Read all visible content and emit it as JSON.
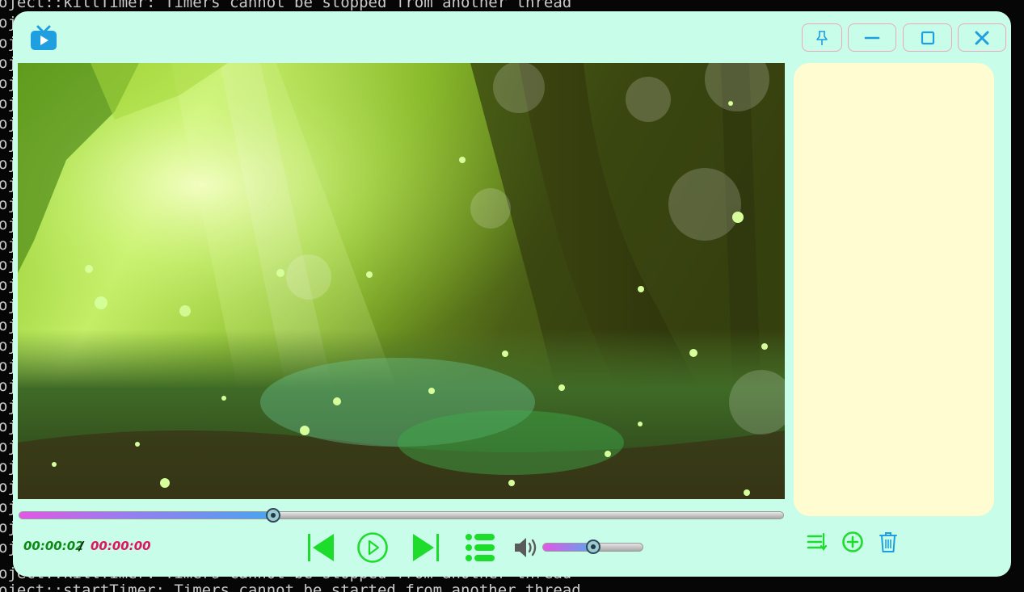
{
  "terminal": {
    "top_line": "oject::killTimer: Timers cannot be stopped from another thread",
    "middle_line": "oject::killTimer: Timers cannot be stopped from another thread",
    "bottom_line": "oject::startTimer: Timers cannot be started from another thread",
    "gutter_char": "oj"
  },
  "window": {
    "app_icon": "tv-play-icon",
    "title_buttons": {
      "pin": "pin-icon",
      "minimize": "minimize-icon",
      "maximize": "maximize-icon",
      "close": "close-icon"
    }
  },
  "playback": {
    "current_time": "00:00:02",
    "separator": "/",
    "total_time": "00:00:00",
    "progress": 0.332,
    "volume": 0.5
  },
  "controls": {
    "previous": "skip-previous-icon",
    "play": "play-circle-icon",
    "next": "skip-next-icon",
    "playlist": "playlist-icon",
    "volume": "volume-icon"
  },
  "playlist_actions": {
    "sort": "sort-icon",
    "add": "add-circle-icon",
    "delete": "trash-icon"
  },
  "colors": {
    "window_bg": "#c8fde9",
    "playlist_bg": "#fefcd0",
    "accent_green": "#1ddc2c",
    "accent_blue": "#1f9fe0",
    "title_button_border": "#f0a5c1",
    "time_current": "#0d8a14",
    "time_total": "#e0145e"
  }
}
